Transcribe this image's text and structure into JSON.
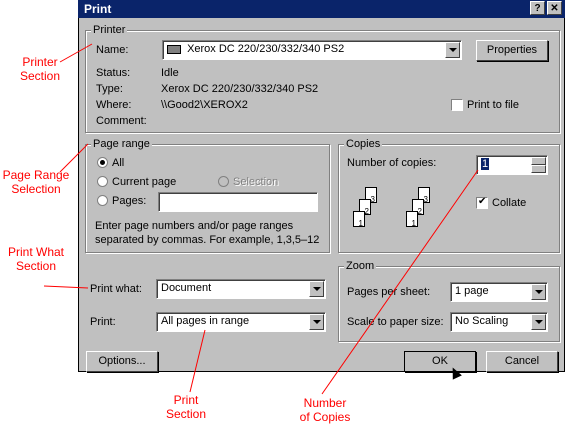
{
  "window": {
    "title": "Print",
    "help_label": "?",
    "close_label": "✕"
  },
  "printer": {
    "group_title": "Printer",
    "name_label": "Name:",
    "name_value": "Xerox DC 220/230/332/340 PS2",
    "properties_label": "Properties",
    "status_label": "Status:",
    "status_value": "Idle",
    "type_label": "Type:",
    "type_value": "Xerox DC 220/230/332/340 PS2",
    "where_label": "Where:",
    "where_value": "\\\\Good2\\XEROX2",
    "comment_label": "Comment:",
    "print_to_file_label": "Print to file"
  },
  "page_range": {
    "group_title": "Page range",
    "all_label": "All",
    "current_page_label": "Current page",
    "selection_label": "Selection",
    "pages_label": "Pages:",
    "help_text_line1": "Enter page numbers and/or page ranges",
    "help_text_line2": "separated by commas.  For example, 1,3,5–12"
  },
  "copies": {
    "group_title": "Copies",
    "number_label": "Number of copies:",
    "number_value": "1",
    "collate_label": "Collate"
  },
  "print_what": {
    "label": "Print what:",
    "value": "Document"
  },
  "print": {
    "label": "Print:",
    "value": "All pages in range"
  },
  "zoom": {
    "group_title": "Zoom",
    "pages_per_sheet_label": "Pages per sheet:",
    "pages_per_sheet_value": "1 page",
    "scale_label": "Scale to paper size:",
    "scale_value": "No Scaling"
  },
  "footer": {
    "options_label": "Options...",
    "ok_label": "OK",
    "cancel_label": "Cancel"
  },
  "annotations": {
    "printer_section": [
      "Printer",
      "Section"
    ],
    "page_range_selection": [
      "Page Range",
      "Selection"
    ],
    "print_what_section": [
      "Print What",
      "Section"
    ],
    "print_section": [
      "Print",
      "Section"
    ],
    "number_of_copies": [
      "Number",
      "of Copies"
    ]
  },
  "colors": {
    "title_bar": "#0a246a",
    "dialog_face": "#c0c0c0",
    "annotation": "#ff0000"
  }
}
